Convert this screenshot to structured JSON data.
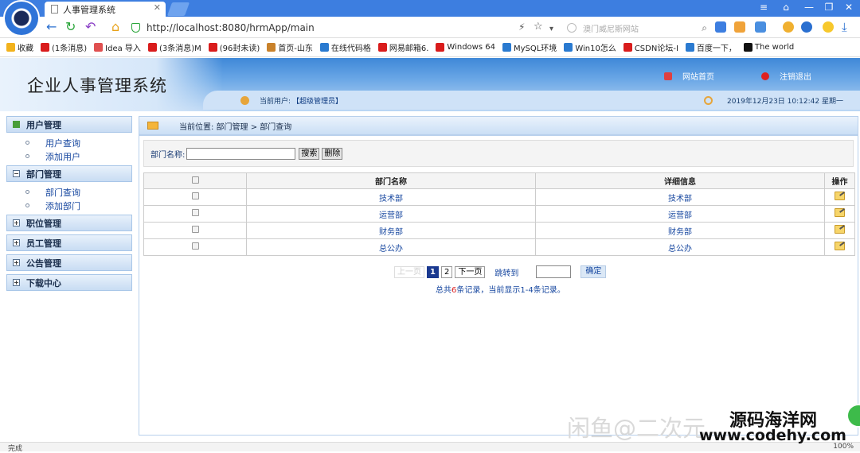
{
  "browser": {
    "tab_title": "人事管理系统",
    "url": "http://localhost:8080/hrmApp/main",
    "search_placeholder": "澳门威尼斯网站",
    "bookmarks": [
      {
        "label": "收藏",
        "color": "#f2b21c"
      },
      {
        "label": "(1条消息)",
        "color": "#d91c1c"
      },
      {
        "label": "Idea 导入",
        "color": "#e05050"
      },
      {
        "label": "(3条消息)M",
        "color": "#d91c1c"
      },
      {
        "label": "(96封未读)",
        "color": "#d91c1c"
      },
      {
        "label": "首页-山东",
        "color": "#c9822b"
      },
      {
        "label": "在线代码格",
        "color": "#2a7ad0"
      },
      {
        "label": "网易邮箱6.",
        "color": "#d91c1c"
      },
      {
        "label": "Windows 64",
        "color": "#d91c1c"
      },
      {
        "label": "MySQL环境",
        "color": "#2a7ad0"
      },
      {
        "label": "Win10怎么",
        "color": "#2a7ad0"
      },
      {
        "label": "CSDN论坛-I",
        "color": "#d91c1c"
      },
      {
        "label": "百度一下，",
        "color": "#2a7ad0"
      },
      {
        "label": "The world",
        "color": "#111111"
      }
    ],
    "status_text": "完成",
    "zoom": "100%"
  },
  "app": {
    "title": "企业人事管理系统",
    "home_link": "网站首页",
    "logout_link": "注销退出",
    "current_user_label": "当前用户:",
    "current_user": "【超级管理员】",
    "datetime": "2019年12月23日  10:12:42  星期一"
  },
  "sidebar": {
    "sections": [
      {
        "label": "用户管理",
        "items": [
          "用户查询",
          "添加用户"
        ]
      },
      {
        "label": "部门管理",
        "items": [
          "部门查询",
          "添加部门"
        ]
      },
      {
        "label": "职位管理",
        "items": []
      },
      {
        "label": "员工管理",
        "items": []
      },
      {
        "label": "公告管理",
        "items": []
      },
      {
        "label": "下载中心",
        "items": []
      }
    ]
  },
  "main": {
    "location": "当前位置: 部门管理 > 部门查询",
    "search_label": "部门名称:",
    "search_value": "",
    "search_button": "搜索",
    "delete_button": "删除",
    "columns": [
      "",
      "部门名称",
      "详细信息",
      "操作"
    ],
    "rows": [
      {
        "name": "技术部",
        "detail": "技术部"
      },
      {
        "name": "运营部",
        "detail": "运营部"
      },
      {
        "name": "财务部",
        "detail": "财务部"
      },
      {
        "name": "总公办",
        "detail": "总公办"
      }
    ],
    "pager": {
      "prev": "上一页",
      "pages": [
        "1",
        "2"
      ],
      "current": "1",
      "next": "下一页",
      "jump_label": "跳转到",
      "jump_button": "确定",
      "summary_prefix": "总共",
      "summary_count": "6",
      "summary_suffix": "条记录，当前显示1-4条记录。"
    }
  },
  "watermark": {
    "line1": "闲鱼@二次元",
    "line2": "源码海洋网",
    "line3": "www.codehy.com"
  }
}
